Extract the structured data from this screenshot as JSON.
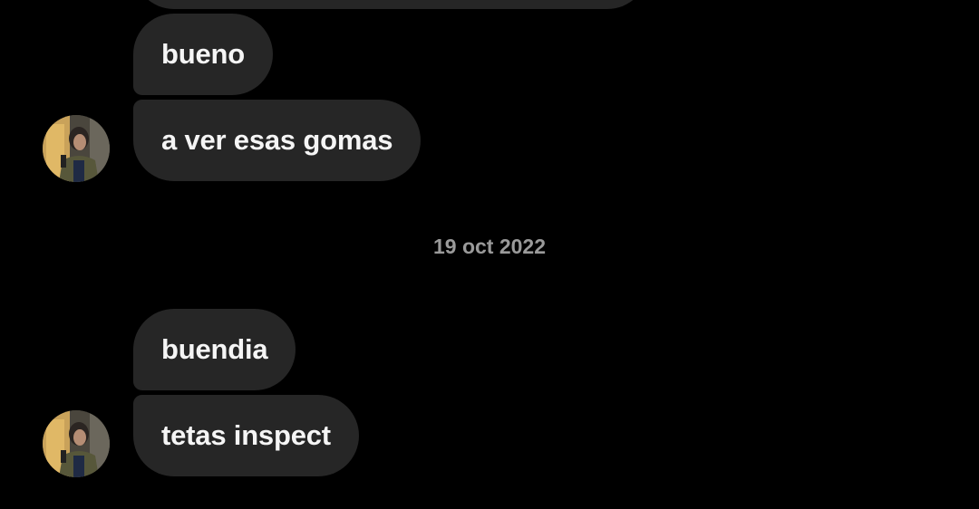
{
  "chat": {
    "colors": {
      "background": "#000000",
      "incoming_bubble": "#262626",
      "message_text": "#f5f5f5",
      "date_text": "#9a9a9a"
    },
    "groups": [
      {
        "avatar_icon": "profile-photo-avatar",
        "messages": [
          {
            "text": ""
          },
          {
            "text": "bueno"
          },
          {
            "text": "a ver esas gomas"
          }
        ]
      },
      {
        "date": "19 oct 2022"
      },
      {
        "avatar_icon": "profile-photo-avatar",
        "messages": [
          {
            "text": "buendia"
          },
          {
            "text": "tetas inspect"
          }
        ]
      }
    ]
  }
}
